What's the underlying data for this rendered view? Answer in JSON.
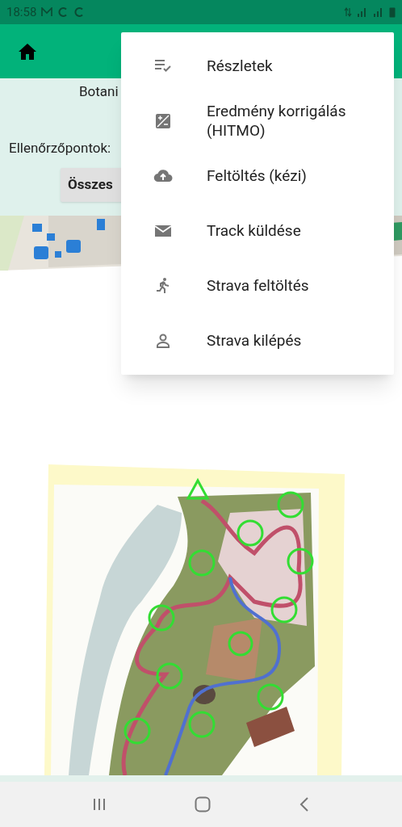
{
  "status_bar": {
    "time": "18:58"
  },
  "content": {
    "title": "Botani",
    "checkpoints_label": "Ellenőrzőpontok:",
    "all_button": "Összes"
  },
  "menu": {
    "items": [
      {
        "kind": "details",
        "label": "Részletek"
      },
      {
        "kind": "correction",
        "label": "Eredmény korrigálás (HITMO)"
      },
      {
        "kind": "upload",
        "label": "Feltöltés (kézi)"
      },
      {
        "kind": "mail",
        "label": "Track küldése"
      },
      {
        "kind": "run",
        "label": "Strava feltöltés"
      },
      {
        "kind": "person",
        "label": "Strava kilépés"
      }
    ]
  }
}
